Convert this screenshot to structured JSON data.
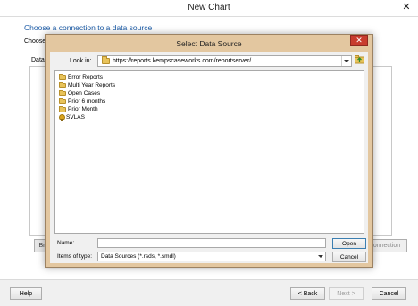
{
  "window": {
    "title": "New Chart",
    "close_glyph": "✕"
  },
  "wizard": {
    "heading": "Choose a connection to a data source",
    "choose_label": "Choose a",
    "data_label": "Data S",
    "left_button_label": "Br",
    "right_button_label": "onnection"
  },
  "footer": {
    "help": "Help",
    "back": "< Back",
    "next": "Next >",
    "cancel": "Cancel"
  },
  "dialog": {
    "title": "Select Data Source",
    "close_glyph": "✕",
    "look_in_label": "Look in:",
    "look_in_value": "https://reports.kempscaseworks.com/reportserver/",
    "items": [
      {
        "label": "Error Reports",
        "icon": "folder-icon"
      },
      {
        "label": "Multi Year Reports",
        "icon": "folder-icon"
      },
      {
        "label": "Open Cases",
        "icon": "folder-icon"
      },
      {
        "label": "Prior 6 months",
        "icon": "folder-icon"
      },
      {
        "label": "Prior Month",
        "icon": "folder-icon"
      },
      {
        "label": "SVLAS",
        "icon": "data-source-icon"
      }
    ],
    "name_label": "Name:",
    "name_value": "",
    "type_label": "Items of type:",
    "type_value": "Data Sources (*.rsds, *.smdl)",
    "open_button": "Open",
    "cancel_button": "Cancel"
  },
  "colors": {
    "heading": "#1a5aa6",
    "dialog_frame": "#e3c7a0",
    "close_red": "#c83c2e",
    "folder": "#e8c35a"
  }
}
